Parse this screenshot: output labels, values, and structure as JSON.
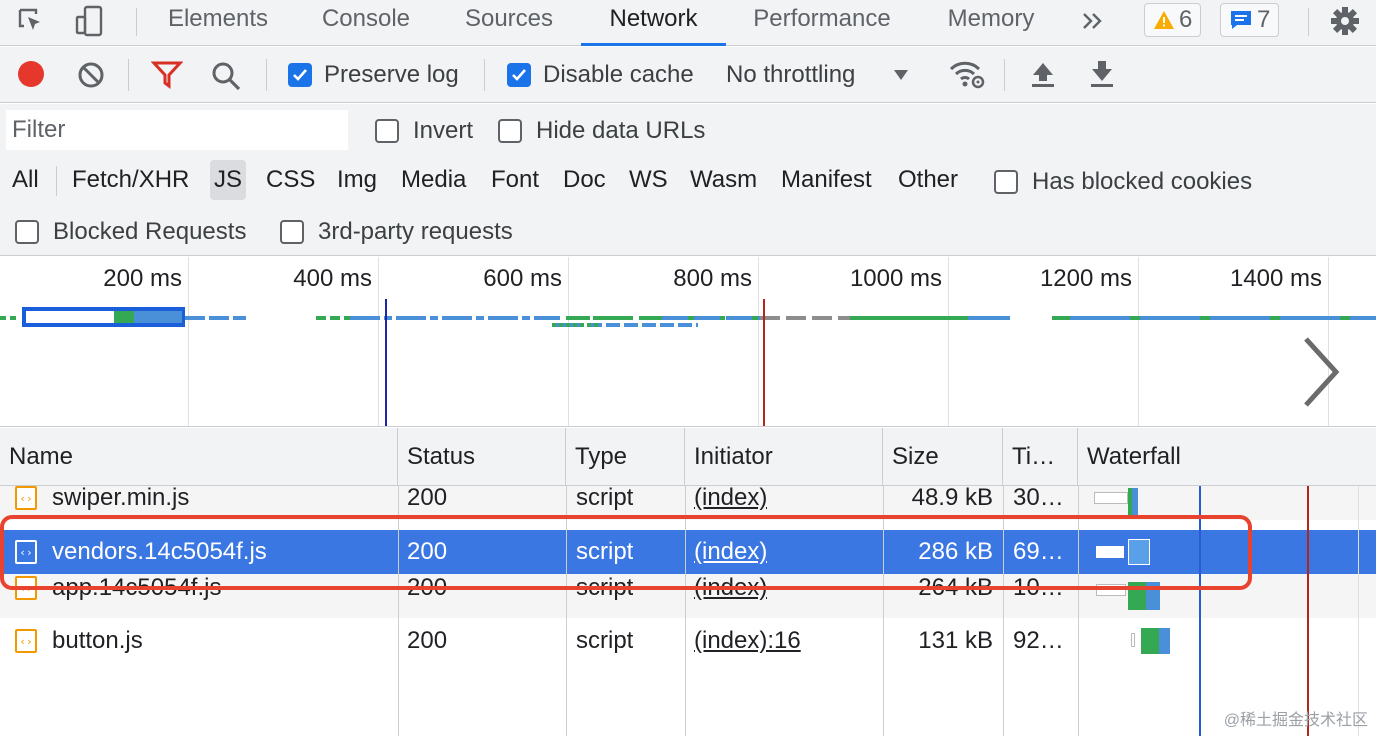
{
  "tabs": [
    {
      "label": "Elements",
      "active": false
    },
    {
      "label": "Console",
      "active": false
    },
    {
      "label": "Sources",
      "active": false
    },
    {
      "label": "Network",
      "active": true
    },
    {
      "label": "Performance",
      "active": false
    },
    {
      "label": "Memory",
      "active": false
    }
  ],
  "tab_overflow_icon": "double-chevron-right-icon",
  "warnings_count": "6",
  "messages_count": "7",
  "toolbar": {
    "preserve_log_label": "Preserve log",
    "preserve_log_checked": true,
    "disable_cache_label": "Disable cache",
    "disable_cache_checked": true,
    "throttling": "No throttling"
  },
  "filter": {
    "placeholder": "Filter",
    "invert_label": "Invert",
    "hide_data_urls_label": "Hide data URLs",
    "types": [
      "All",
      "Fetch/XHR",
      "JS",
      "CSS",
      "Img",
      "Media",
      "Font",
      "Doc",
      "WS",
      "Wasm",
      "Manifest",
      "Other"
    ],
    "active_type": "JS",
    "has_blocked_cookies_label": "Has blocked cookies",
    "blocked_requests_label": "Blocked Requests",
    "third_party_label": "3rd-party requests"
  },
  "overview": {
    "ticks": [
      "200 ms",
      "400 ms",
      "600 ms",
      "800 ms",
      "1000 ms",
      "1200 ms",
      "1400 ms"
    ]
  },
  "table": {
    "headers": {
      "name": "Name",
      "status": "Status",
      "type": "Type",
      "initiator": "Initiator",
      "size": "Size",
      "time": "Ti…",
      "waterfall": "Waterfall"
    },
    "rows": [
      {
        "name": "swiper.min.js",
        "status": "200",
        "type": "script",
        "initiator": "(index)",
        "size": "48.9 kB",
        "time": "30…",
        "selected": false
      },
      {
        "name": "vendors.14c5054f.js",
        "status": "200",
        "type": "script",
        "initiator": "(index)",
        "size": "286 kB",
        "time": "69…",
        "selected": true
      },
      {
        "name": "app.14c5054f.js",
        "status": "200",
        "type": "script",
        "initiator": "(index)",
        "size": "264 kB",
        "time": "10…",
        "selected": false
      },
      {
        "name": "button.js",
        "status": "200",
        "type": "script",
        "initiator": "(index):16",
        "size": "131 kB",
        "time": "92…",
        "selected": false
      }
    ]
  },
  "colors": {
    "accent": "#1a73e8",
    "selected_row": "#3b77e3",
    "highlight": "#e8432f",
    "record": "#e5372c"
  },
  "watermark": "@稀土掘金技术社区"
}
